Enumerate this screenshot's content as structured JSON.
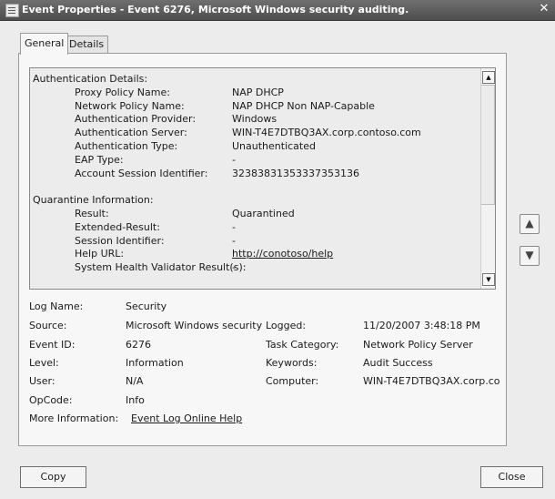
{
  "window": {
    "title": "Event Properties - Event 6276, Microsoft Windows security auditing.",
    "close_glyph": "✕"
  },
  "tabs": [
    {
      "label": "General",
      "active": true
    },
    {
      "label": "Details",
      "active": false
    }
  ],
  "details": {
    "auth_header": "Authentication Details:",
    "auth_rows": [
      {
        "label": "Proxy Policy Name:",
        "value": "NAP DHCP"
      },
      {
        "label": "Network Policy Name:",
        "value": "NAP DHCP Non NAP-Capable"
      },
      {
        "label": "Authentication Provider:",
        "value": "Windows"
      },
      {
        "label": "Authentication Server:",
        "value": "WIN-T4E7DTBQ3AX.corp.contoso.com"
      },
      {
        "label": "Authentication Type:",
        "value": "Unauthenticated"
      },
      {
        "label": "EAP Type:",
        "value": "-"
      },
      {
        "label": "Account Session Identifier:",
        "value": "32383831353337353136"
      }
    ],
    "quarantine_header": "Quarantine Information:",
    "quarantine_rows": [
      {
        "label": "Result:",
        "value": "Quarantined"
      },
      {
        "label": "Extended-Result:",
        "value": "-"
      },
      {
        "label": "Session Identifier:",
        "value": "-"
      },
      {
        "label": "Help URL:",
        "value": "http://conotoso/help"
      },
      {
        "label": "System Health Validator Result(s):",
        "value": "-"
      }
    ],
    "scroll_up_glyph": "▲",
    "scroll_down_glyph": "▼"
  },
  "meta": {
    "log_name": {
      "label": "Log Name:",
      "value": "Security"
    },
    "source": {
      "label": "Source:",
      "value": "Microsoft Windows security"
    },
    "logged": {
      "label": "Logged:",
      "value": "11/20/2007 3:48:18 PM"
    },
    "event_id": {
      "label": "Event ID:",
      "value": "6276"
    },
    "task_category": {
      "label": "Task Category:",
      "value": "Network Policy Server"
    },
    "level": {
      "label": "Level:",
      "value": "Information"
    },
    "keywords": {
      "label": "Keywords:",
      "value": "Audit Success"
    },
    "user": {
      "label": "User:",
      "value": "N/A"
    },
    "computer": {
      "label": "Computer:",
      "value": "WIN-T4E7DTBQ3AX.corp.co"
    },
    "opcode": {
      "label": "OpCode:",
      "value": "Info"
    },
    "more_info": {
      "label": "More Information:",
      "value": "Event Log Online Help"
    }
  },
  "nav": {
    "up_glyph": "▲",
    "down_glyph": "▼"
  },
  "buttons": {
    "copy": "Copy",
    "close": "Close"
  }
}
